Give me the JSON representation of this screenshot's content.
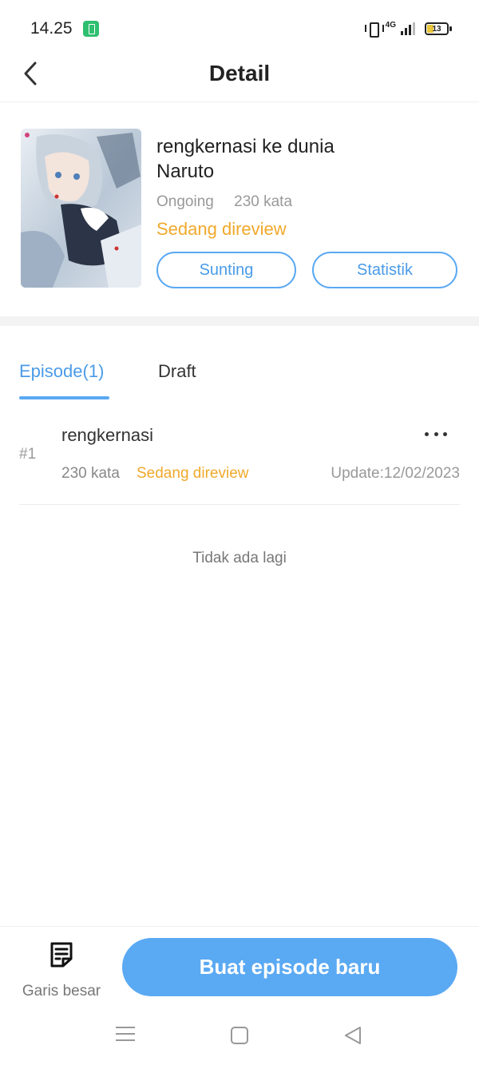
{
  "status_bar": {
    "time": "14.25",
    "network": "4G",
    "battery_level": "13"
  },
  "header": {
    "title": "Detail"
  },
  "book": {
    "title": "rengkernasi ke dunia Naruto",
    "state": "Ongoing",
    "word_count": "230 kata",
    "review_status": "Sedang direview",
    "edit_label": "Sunting",
    "stats_label": "Statistik"
  },
  "tabs": {
    "episodes": "Episode(1)",
    "draft": "Draft",
    "active": "episodes"
  },
  "episodes": [
    {
      "number": "#1",
      "title": "rengkernasi",
      "words": "230 kata",
      "status": "Sedang direview",
      "updated": "Update:12/02/2023"
    }
  ],
  "list_end_text": "Tidak ada lagi",
  "bottom_bar": {
    "outline_label": "Garis besar",
    "create_label": "Buat episode baru"
  },
  "colors": {
    "accent": "#5aa9f3",
    "status": "#f0a92b"
  }
}
